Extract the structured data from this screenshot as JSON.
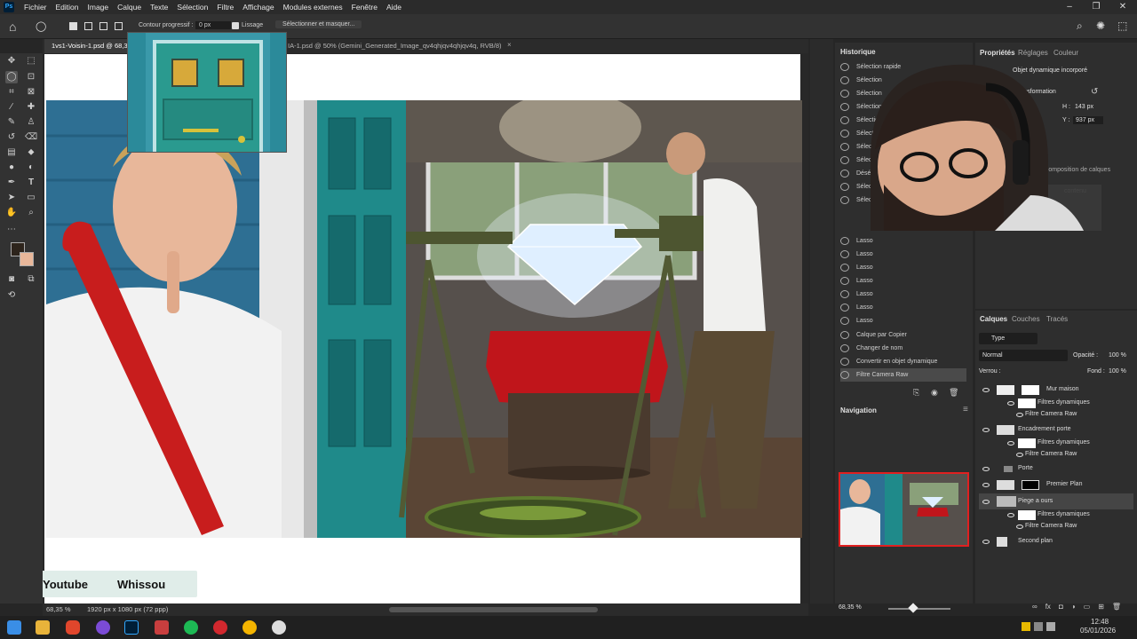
{
  "app": {
    "icon": "Ps"
  },
  "menu": [
    "Fichier",
    "Edition",
    "Image",
    "Calque",
    "Texte",
    "Sélection",
    "Filtre",
    "Affichage",
    "Modules externes",
    "Fenêtre",
    "Aide"
  ],
  "options": {
    "feather_label": "Contour progressif :",
    "feather_value": "0 px",
    "smooth_label": "Lissage",
    "select_mask": "Sélectionner et masquer..."
  },
  "tabs": [
    {
      "label": "1vs1-Voisin-1.psd @ 68,3"
    },
    {
      "label": "IA-1.psd @ 50% (Gemini_Generated_Image_qv4qhjqv4qhjqv4q, RVB/8)"
    }
  ],
  "status": {
    "zoom": "68,35 %",
    "doc_size": "1920 px x 1080 px (72 ppp)"
  },
  "overlay": {
    "youtube": "Youtube",
    "name": "Whissou"
  },
  "history": {
    "tab": "Historique",
    "items": [
      "Sélection rapide",
      "Sélection",
      "Sélection",
      "Sélection",
      "Sélection",
      "Sélection",
      "Sélection",
      "Sélection",
      "Désélectionner",
      "Sélection",
      "Sélection",
      "Lasso",
      "Lasso",
      "Lasso",
      "Lasso",
      "Lasso",
      "Lasso",
      "Lasso",
      "Calque par Copier",
      "Changer de nom",
      "Convertir en objet dynamique",
      "Filtre Camera Raw"
    ]
  },
  "properties": {
    "tabs": [
      "Propriétés",
      "Réglages",
      "Couleur"
    ],
    "type": "Objet dynamique incorporé",
    "transform": "Transformation",
    "h_label": "H :",
    "h_value": "143 px",
    "y_label": "Y :",
    "y_value": "937 px",
    "composition": "Appliquer la composition de calques",
    "contenu": "contenu"
  },
  "navigation": {
    "tab": "Navigation",
    "zoom": "68,35 %"
  },
  "layers": {
    "tabs": [
      "Calques",
      "Couches",
      "Tracés"
    ],
    "filter": "Type",
    "blend": "Normal",
    "opacity_label": "Opacité :",
    "opacity": "100 %",
    "lock_label": "Verrou :",
    "fill_label": "Fond :",
    "fill": "100 %",
    "rows": [
      {
        "name": "Mur maison",
        "kind": "layer"
      },
      {
        "name": "Filtres dynamiques",
        "kind": "filter"
      },
      {
        "name": "Filtre Camera Raw",
        "kind": "sub"
      },
      {
        "name": "Encadrement porte",
        "kind": "layer"
      },
      {
        "name": "Filtres dynamiques",
        "kind": "filter"
      },
      {
        "name": "Filtre Camera Raw",
        "kind": "sub"
      },
      {
        "name": "Porte",
        "kind": "group"
      },
      {
        "name": "Premier Plan",
        "kind": "layer"
      },
      {
        "name": "Piege a ours",
        "kind": "layer"
      },
      {
        "name": "Filtres dynamiques",
        "kind": "filter"
      },
      {
        "name": "Filtre Camera Raw",
        "kind": "sub"
      },
      {
        "name": "Second plan",
        "kind": "layer"
      }
    ]
  },
  "clock": {
    "time": "12:48",
    "date": "05/01/2026"
  },
  "colors": {
    "accent": "#31a8ff",
    "teal": "#1f8a8a",
    "red_cloth": "#c0151b"
  }
}
